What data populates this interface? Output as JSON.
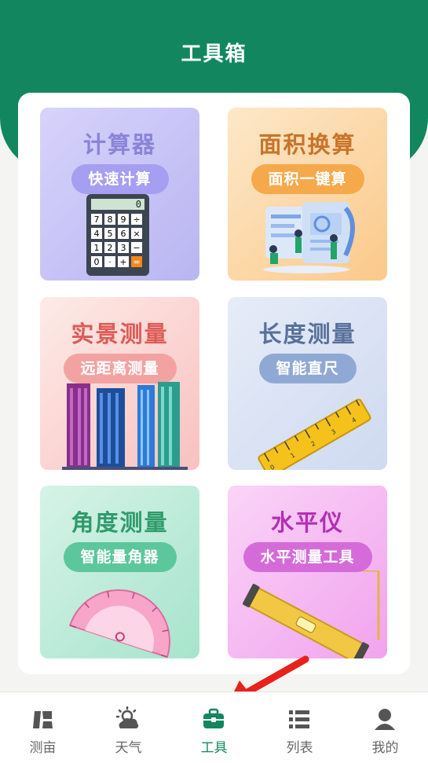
{
  "header": {
    "title": "工具箱"
  },
  "tools": [
    {
      "title": "计算器",
      "subtitle": "快速计算"
    },
    {
      "title": "面积换算",
      "subtitle": "面积一键算"
    },
    {
      "title": "实景测量",
      "subtitle": "远距离测量"
    },
    {
      "title": "长度测量",
      "subtitle": "智能直尺"
    },
    {
      "title": "角度测量",
      "subtitle": "智能量角器"
    },
    {
      "title": "水平仪",
      "subtitle": "水平测量工具"
    }
  ],
  "calculator_keys": [
    "0",
    "7",
    "8",
    "9",
    "÷",
    "4",
    "5",
    "6",
    "×",
    "1",
    "2",
    "3",
    "−",
    "0",
    "·",
    "+",
    "="
  ],
  "ruler_numbers": [
    "0",
    "1",
    "2",
    "3",
    "4",
    "5",
    "6",
    "7",
    "8",
    "9"
  ],
  "nav": [
    {
      "label": "测亩",
      "icon": "field-icon"
    },
    {
      "label": "天气",
      "icon": "weather-icon"
    },
    {
      "label": "工具",
      "icon": "toolbox-icon",
      "active": true
    },
    {
      "label": "列表",
      "icon": "list-icon"
    },
    {
      "label": "我的",
      "icon": "profile-icon"
    }
  ],
  "colors": {
    "brand": "#12875f",
    "arrow": "#e8211c"
  }
}
